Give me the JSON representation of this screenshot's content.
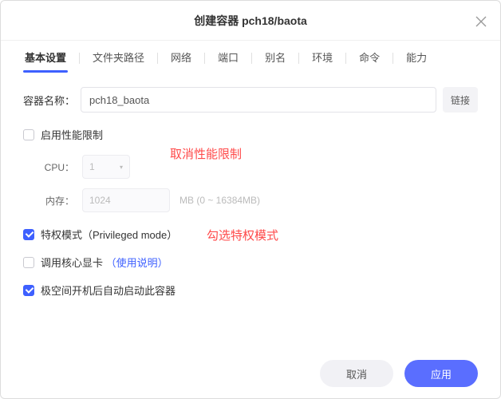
{
  "header": {
    "title": "创建容器 pch18/baota"
  },
  "tabs": [
    "基本设置",
    "文件夹路径",
    "网络",
    "端口",
    "别名",
    "环境",
    "命令",
    "能力"
  ],
  "active_tab_index": 0,
  "basic": {
    "name_label": "容器名称：",
    "name_value": "pch18_baota",
    "link_btn": "链接",
    "perf_label": "启用性能限制",
    "cpu_label": "CPU：",
    "cpu_value": "1",
    "mem_label": "内存：",
    "mem_value": "1024",
    "mem_hint": "MB (0 ~ 16384MB)",
    "priv_label": "特权模式（Privileged mode）",
    "gpu_label": "调用核心显卡",
    "gpu_help": "（使用说明）",
    "autostart_label": "极空间开机后自动启动此容器"
  },
  "annotations": {
    "perf": "取消性能限制",
    "priv": "勾选特权模式"
  },
  "footer": {
    "cancel": "取消",
    "apply": "应用"
  }
}
